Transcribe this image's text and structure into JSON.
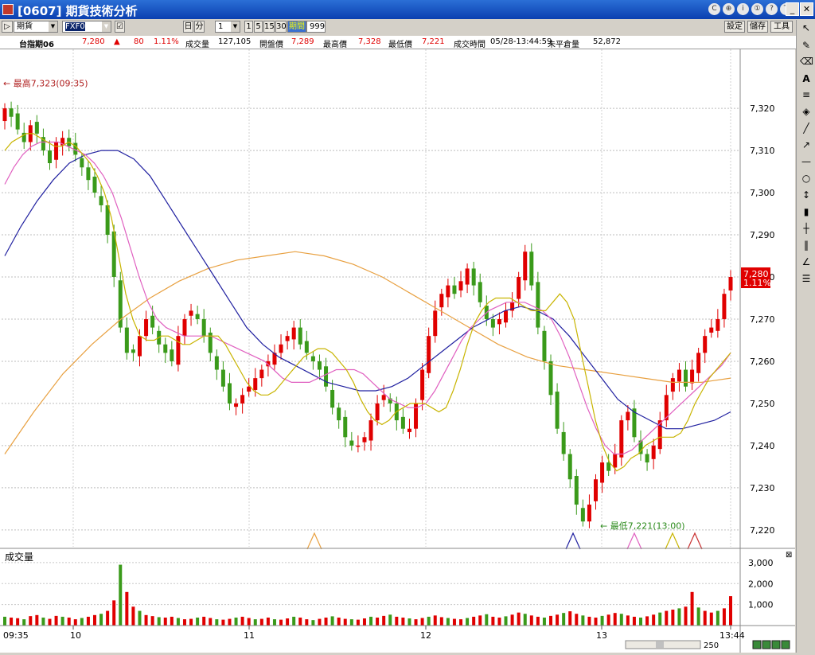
{
  "window": {
    "title": "[0607] 期貨技術分析"
  },
  "titlebar_buttons": [
    "C",
    "⊕",
    "i",
    "①",
    "?",
    "T"
  ],
  "toolbar": {
    "type_select": "期貨",
    "code_select": "FXF0",
    "day_btn": "日",
    "min_btn": "分",
    "interval_select": "1",
    "quick_intervals": [
      "1",
      "5",
      "15",
      "30"
    ],
    "period_label": "期間",
    "period_value": "999",
    "settings": "設定",
    "save": "儲存",
    "tools": "工具"
  },
  "quote": {
    "name": "台指期06",
    "last": "7,280",
    "change": "80",
    "pct": "1.11%",
    "volume_label": "成交量",
    "volume": "127,105",
    "open_label": "開盤價",
    "open": "7,289",
    "high_label": "最高價",
    "high": "7,328",
    "low_label": "最低價",
    "low": "7,221",
    "time_label": "成交時間",
    "time": "05/28-13:44:59",
    "oi_label": "未平倉量",
    "oi": "52,872"
  },
  "colors": {
    "up": "#e00000",
    "down": "#3a9a1a",
    "ma5": "#c8b400",
    "ma10": "#e060c0",
    "ma20": "#c83030",
    "ma60": "#2020a0",
    "ma_long": "#e8a040"
  },
  "chart_data": {
    "type": "candlestick",
    "y_ticks": [
      "7,320",
      "7,310",
      "7,300",
      "7,290",
      "7,280",
      "7,270",
      "7,260",
      "7,250",
      "7,240",
      "7,230",
      "7,220"
    ],
    "y_values": [
      7320,
      7310,
      7300,
      7290,
      7280,
      7270,
      7260,
      7250,
      7240,
      7230,
      7220
    ],
    "ylim": [
      7216,
      7334
    ],
    "x_labels": [
      "09:35",
      "10",
      "11",
      "12",
      "13",
      "13:44"
    ],
    "high_annotation": "最高7,323(09:35)",
    "low_annotation": "最低7,221(13:00)",
    "last_price_tag": "7,280",
    "last_pct_tag": "1.11%",
    "price_series": [
      7320,
      7318,
      7315,
      7312,
      7316,
      7314,
      7310,
      7307,
      7312,
      7313,
      7311,
      7309,
      7306,
      7303,
      7300,
      7297,
      7290,
      7280,
      7268,
      7262,
      7262,
      7266,
      7270,
      7268,
      7264,
      7262,
      7260,
      7266,
      7270,
      7272,
      7270,
      7266,
      7262,
      7258,
      7254,
      7250,
      7250,
      7252,
      7254,
      7256,
      7258,
      7260,
      7262,
      7264,
      7266,
      7268,
      7264,
      7262,
      7260,
      7258,
      7254,
      7249,
      7246,
      7242,
      7240,
      7240,
      7242,
      7246,
      7250,
      7252,
      7250,
      7246,
      7244,
      7244,
      7250,
      7258,
      7266,
      7272,
      7276,
      7278,
      7276,
      7279,
      7282,
      7278,
      7274,
      7270,
      7268,
      7270,
      7272,
      7274,
      7280,
      7286,
      7278,
      7268,
      7260,
      7252,
      7244,
      7238,
      7232,
      7226,
      7222,
      7226,
      7232,
      7236,
      7234,
      7238,
      7246,
      7248,
      7242,
      7238,
      7236,
      7240,
      7246,
      7252,
      7256,
      7258,
      7254,
      7258,
      7262,
      7266,
      7268,
      7270,
      7276,
      7280
    ],
    "ma5_series": [
      7310,
      7312,
      7313,
      7314,
      7314,
      7313,
      7312,
      7311,
      7311,
      7312,
      7311,
      7309,
      7307,
      7304,
      7300,
      7294,
      7285,
      7276,
      7270,
      7266,
      7265,
      7265,
      7266,
      7266,
      7265,
      7264,
      7264,
      7265,
      7266,
      7266,
      7266,
      7264,
      7261,
      7258,
      7255,
      7253,
      7252,
      7252,
      7253,
      7255,
      7257,
      7259,
      7261,
      7262,
      7263,
      7263,
      7262,
      7260,
      7258,
      7255,
      7251,
      7248,
      7246,
      7245,
      7246,
      7248,
      7249,
      7250,
      7250,
      7250,
      7249,
      7248,
      7249,
      7253,
      7258,
      7264,
      7269,
      7272,
      7274,
      7275,
      7275,
      7275,
      7274,
      7273,
      7272,
      7272,
      7272,
      7274,
      7276,
      7274,
      7270,
      7262,
      7254,
      7246,
      7240,
      7236,
      7234,
      7235,
      7237,
      7238,
      7240,
      7241,
      7242,
      7242,
      7242,
      7243,
      7246,
      7250,
      7253,
      7256,
      7258,
      7260,
      7262
    ],
    "ma10_series": [
      7302,
      7306,
      7309,
      7311,
      7312,
      7312,
      7312,
      7311,
      7310,
      7309,
      7307,
      7304,
      7300,
      7294,
      7287,
      7280,
      7274,
      7270,
      7268,
      7267,
      7266,
      7266,
      7266,
      7266,
      7265,
      7264,
      7263,
      7262,
      7261,
      7260,
      7258,
      7256,
      7255,
      7255,
      7255,
      7256,
      7257,
      7258,
      7258,
      7258,
      7257,
      7255,
      7253,
      7251,
      7250,
      7249,
      7249,
      7250,
      7253,
      7257,
      7261,
      7265,
      7268,
      7270,
      7272,
      7273,
      7274,
      7274,
      7274,
      7273,
      7272,
      7270,
      7266,
      7261,
      7255,
      7249,
      7244,
      7240,
      7238,
      7238,
      7239,
      7241,
      7243,
      7245,
      7247,
      7249,
      7251,
      7253,
      7255,
      7257,
      7259,
      7262
    ],
    "ma60_series": [
      7285,
      7292,
      7298,
      7303,
      7307,
      7309,
      7310,
      7310,
      7308,
      7304,
      7298,
      7292,
      7286,
      7280,
      7274,
      7268,
      7264,
      7261,
      7259,
      7257,
      7255,
      7254,
      7253,
      7253,
      7254,
      7256,
      7259,
      7262,
      7265,
      7268,
      7270,
      7272,
      7273,
      7272,
      7270,
      7266,
      7261,
      7256,
      7251,
      7248,
      7246,
      7244,
      7244,
      7245,
      7246,
      7248
    ],
    "ma_long_series": [
      7238,
      7248,
      7257,
      7264,
      7270,
      7275,
      7279,
      7282,
      7284,
      7285,
      7286,
      7285,
      7283,
      7280,
      7276,
      7272,
      7268,
      7264,
      7261,
      7259,
      7258,
      7257,
      7256,
      7255,
      7255,
      7256
    ],
    "volume_panel": {
      "title": "成交量",
      "y_ticks": [
        "3,000",
        "2,000",
        "1,000"
      ],
      "y_values": [
        3000,
        2000,
        1000
      ],
      "ylim": [
        0,
        3300
      ],
      "values": [
        420,
        380,
        350,
        300,
        450,
        500,
        380,
        320,
        460,
        420,
        380,
        300,
        360,
        420,
        500,
        560,
        700,
        1200,
        2900,
        1600,
        900,
        700,
        500,
        450,
        400,
        380,
        420,
        360,
        300,
        320,
        380,
        420,
        360,
        300,
        280,
        320,
        380,
        420,
        360,
        300,
        320,
        380,
        300,
        280,
        340,
        420,
        380,
        300,
        260,
        320,
        380,
        440,
        380,
        320,
        300,
        280,
        340,
        420,
        380,
        460,
        520,
        420,
        380,
        340,
        300,
        360,
        420,
        480,
        400,
        360,
        320,
        300,
        360,
        420,
        480,
        540,
        420,
        380,
        440,
        520,
        620,
        560,
        480,
        420,
        380,
        460,
        520,
        600,
        680,
        560,
        480,
        420,
        380,
        460,
        520,
        600,
        560,
        480,
        420,
        380,
        440,
        520,
        620,
        700,
        760,
        820,
        900,
        1600,
        860,
        700,
        620,
        700,
        820,
        1400
      ]
    }
  },
  "sidebar_icons": [
    "cursor-icon",
    "brush-icon",
    "eraser-icon",
    "text-icon",
    "lines-icon",
    "fill-icon",
    "line-icon",
    "arrow-line-icon",
    "hline-icon",
    "circle-icon",
    "vline-icon",
    "candle-icon",
    "bars-icon",
    "vbars-icon",
    "fan-icon",
    "grid-icon"
  ],
  "zoom_value": "250"
}
